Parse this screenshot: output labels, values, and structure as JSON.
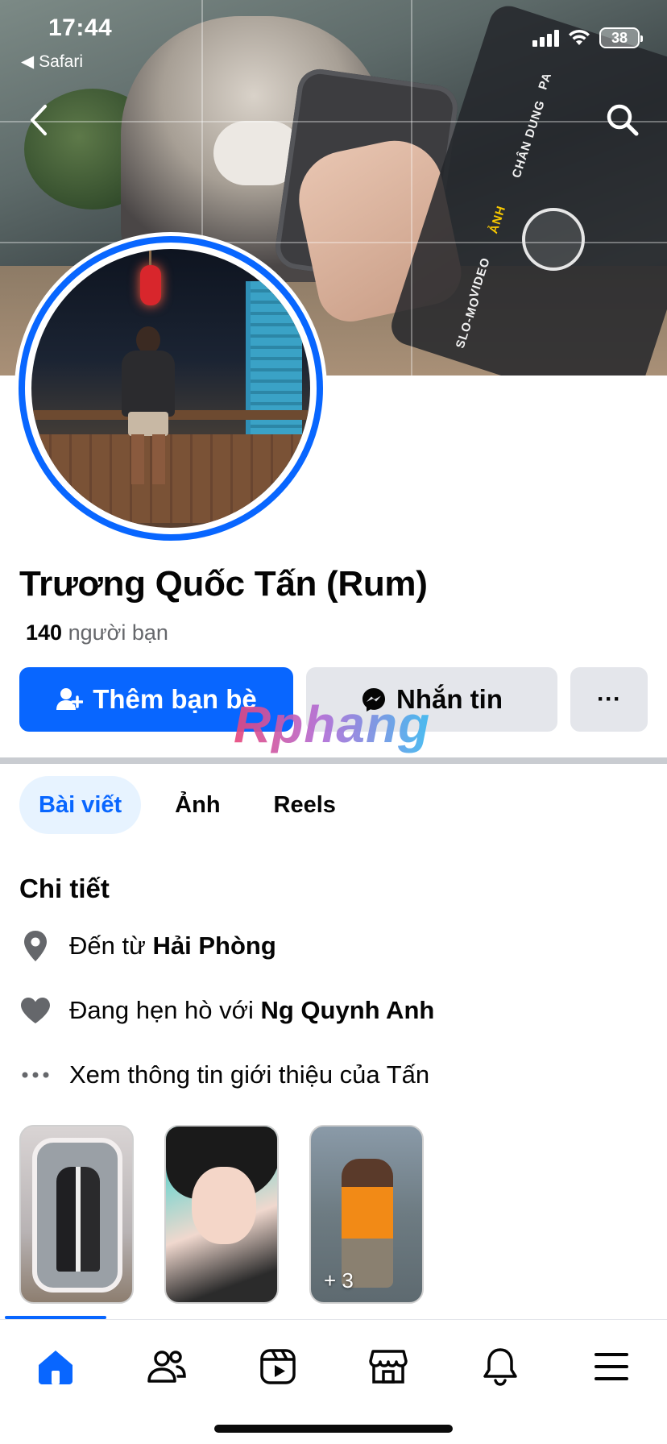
{
  "status_bar": {
    "time": "17:44",
    "back_app": "Safari",
    "battery": "38"
  },
  "cover": {
    "camera_modes": [
      "SLO-MO",
      "VIDEO",
      "ẢNH",
      "CHÂN DUNG",
      "PA"
    ],
    "active_mode": "ẢNH"
  },
  "profile": {
    "name": "Trương Quốc Tấn (Rum)",
    "friend_count": "140",
    "friend_label": "người bạn"
  },
  "actions": {
    "add_friend": "Thêm bạn bè",
    "message": "Nhắn tin",
    "more": "···"
  },
  "watermark": "Rphang",
  "tabs": [
    {
      "label": "Bài viết",
      "active": true
    },
    {
      "label": "Ảnh",
      "active": false
    },
    {
      "label": "Reels",
      "active": false
    }
  ],
  "details": {
    "title": "Chi tiết",
    "hometown_prefix": "Đến từ",
    "hometown": "Hải Phòng",
    "relationship_prefix": "Đang hẹn hò với",
    "relationship_partner": "Ng Quynh Anh",
    "see_about": "Xem thông tin giới thiệu của Tấn"
  },
  "featured": {
    "third_overlay": "+ 3"
  },
  "colors": {
    "accent": "#0866ff",
    "secondary_button": "#e4e6eb",
    "tab_active_bg": "#e7f3ff",
    "muted_text": "#65676b"
  },
  "bottom_nav": [
    "home-icon",
    "friends-icon",
    "video-icon",
    "marketplace-icon",
    "bell-icon",
    "menu-icon"
  ]
}
